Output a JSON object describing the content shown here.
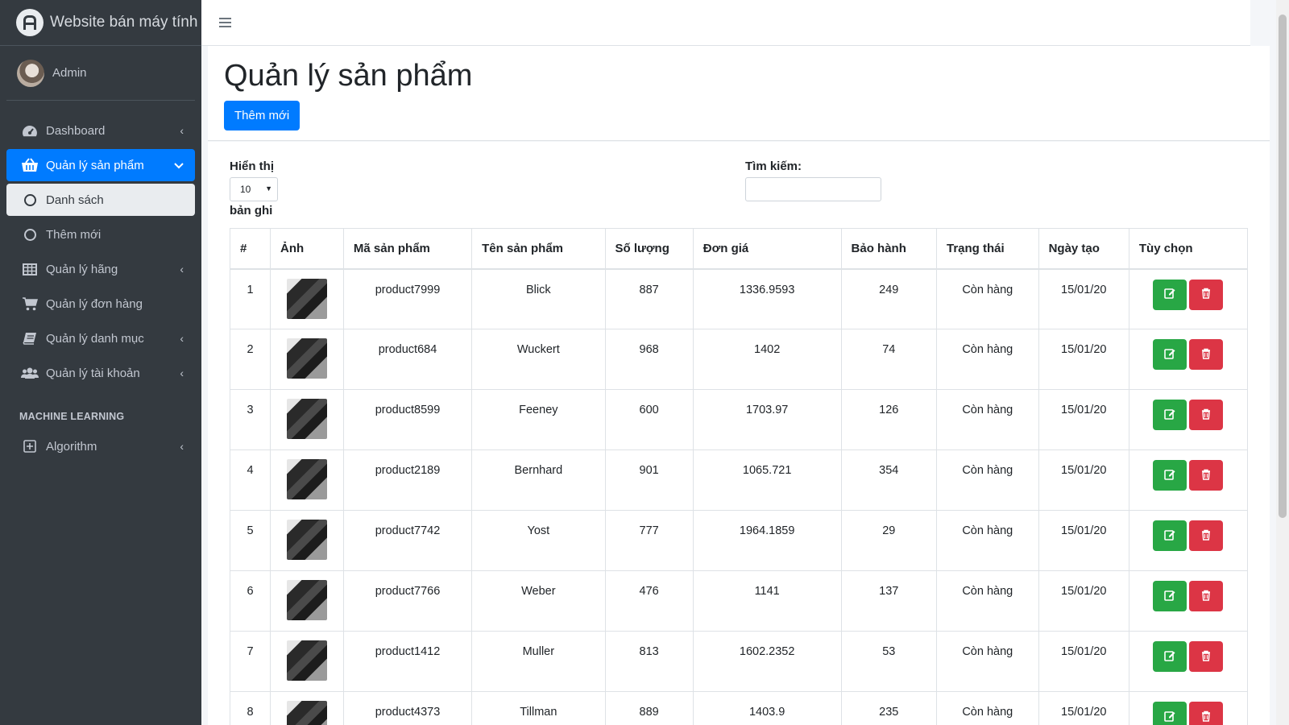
{
  "brand": {
    "title": "Website bán máy tính"
  },
  "user": {
    "name": "Admin"
  },
  "sidebar": {
    "items": [
      {
        "label": "Dashboard",
        "icon": "tachometer-icon",
        "chevron": "‹"
      },
      {
        "label": "Quản lý sản phẩm",
        "icon": "basket-icon",
        "chevron": "⌄"
      },
      {
        "label": "Danh sách",
        "icon": "circle-icon"
      },
      {
        "label": "Thêm mới",
        "icon": "circle-icon"
      },
      {
        "label": "Quản lý hãng",
        "icon": "table-icon",
        "chevron": "‹"
      },
      {
        "label": "Quản lý đơn hàng",
        "icon": "cart-icon"
      },
      {
        "label": "Quản lý danh mục",
        "icon": "book-icon",
        "chevron": "‹"
      },
      {
        "label": "Quản lý tài khoản",
        "icon": "users-icon",
        "chevron": "‹"
      }
    ],
    "section_header": "MACHINE LEARNING",
    "ml_items": [
      {
        "label": "Algorithm",
        "icon": "plus-square-icon",
        "chevron": "‹"
      }
    ]
  },
  "page": {
    "title": "Quản lý sản phẩm",
    "add_button": "Thêm mới"
  },
  "controls": {
    "length_label": "Hiển thị",
    "length_value": "10",
    "length_suffix": "bản ghi",
    "search_label": "Tìm kiếm:",
    "search_value": ""
  },
  "table": {
    "headers": [
      "#",
      "Ảnh",
      "Mã sản phẩm",
      "Tên sản phẩm",
      "Số lượng",
      "Đơn giá",
      "Bảo hành",
      "Trạng thái",
      "Ngày tạo",
      "Tùy chọn"
    ],
    "rows": [
      {
        "idx": "1",
        "code": "product7999",
        "name": "Blick",
        "qty": "887",
        "price": "1336.9593",
        "warranty": "249",
        "status": "Còn hàng",
        "date": "15/01/20"
      },
      {
        "idx": "2",
        "code": "product684",
        "name": "Wuckert",
        "qty": "968",
        "price": "1402",
        "warranty": "74",
        "status": "Còn hàng",
        "date": "15/01/20"
      },
      {
        "idx": "3",
        "code": "product8599",
        "name": "Feeney",
        "qty": "600",
        "price": "1703.97",
        "warranty": "126",
        "status": "Còn hàng",
        "date": "15/01/20"
      },
      {
        "idx": "4",
        "code": "product2189",
        "name": "Bernhard",
        "qty": "901",
        "price": "1065.721",
        "warranty": "354",
        "status": "Còn hàng",
        "date": "15/01/20"
      },
      {
        "idx": "5",
        "code": "product7742",
        "name": "Yost",
        "qty": "777",
        "price": "1964.1859",
        "warranty": "29",
        "status": "Còn hàng",
        "date": "15/01/20"
      },
      {
        "idx": "6",
        "code": "product7766",
        "name": "Weber",
        "qty": "476",
        "price": "1141",
        "warranty": "137",
        "status": "Còn hàng",
        "date": "15/01/20"
      },
      {
        "idx": "7",
        "code": "product1412",
        "name": "Muller",
        "qty": "813",
        "price": "1602.2352",
        "warranty": "53",
        "status": "Còn hàng",
        "date": "15/01/20"
      },
      {
        "idx": "8",
        "code": "product4373",
        "name": "Tillman",
        "qty": "889",
        "price": "1403.9",
        "warranty": "235",
        "status": "Còn hàng",
        "date": "15/01/20"
      }
    ]
  },
  "colors": {
    "primary": "#007bff",
    "success": "#28a745",
    "danger": "#dc3545",
    "sidebar_bg": "#343a40"
  }
}
